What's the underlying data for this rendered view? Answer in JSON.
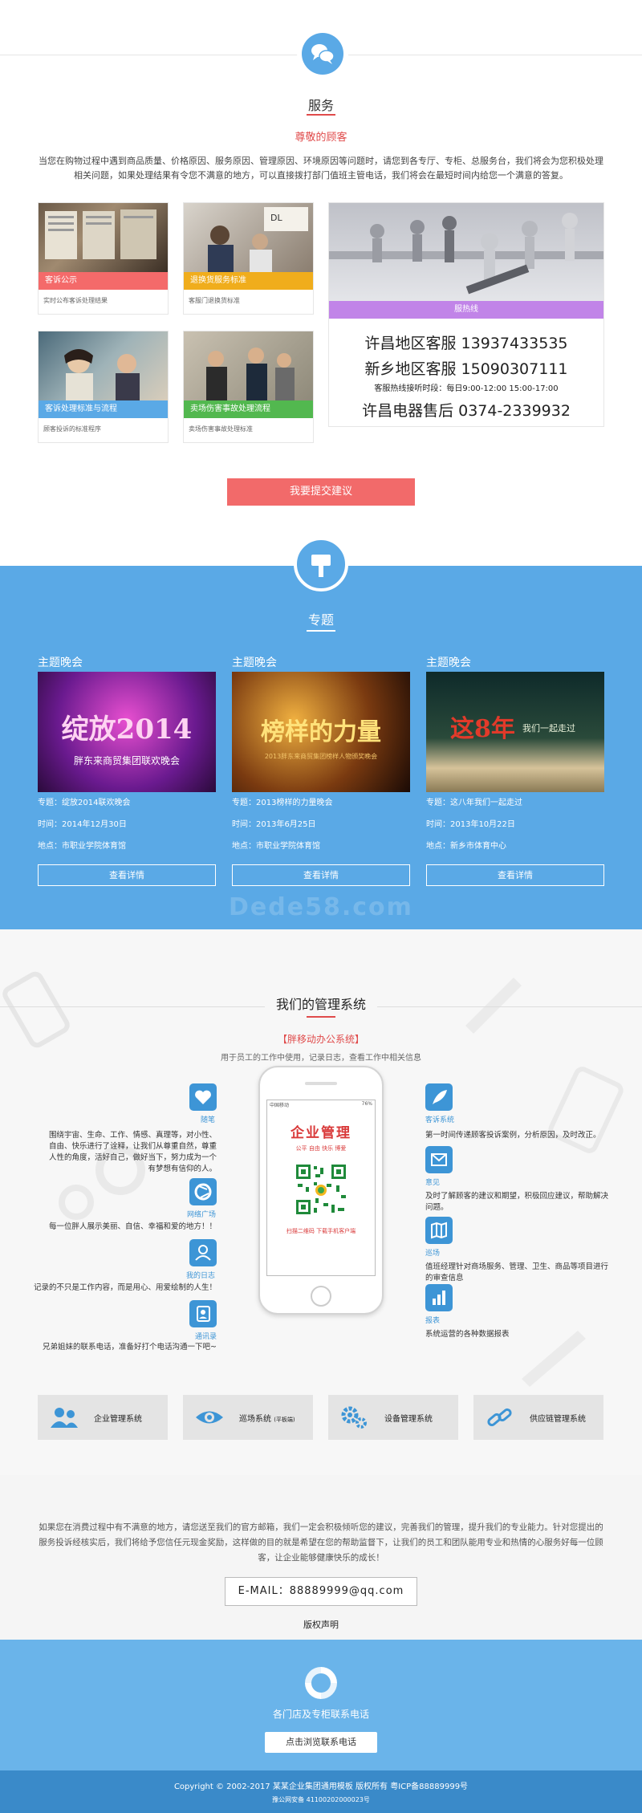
{
  "service": {
    "title": "服务",
    "subtitle": "尊敬的顾客",
    "description": "当您在购物过程中遇到商品质量、价格原因、服务原因、管理原因、环境原因等问题时，请您到各专厅、专柜、总服务台，我们将会为您积极处理相关问题，如果处理结果有令您不满意的地方，可以直接拨打部门值班主管电话，我们将会在最短时间内给您一个满意的答复。",
    "cards": [
      {
        "label": "客诉公示",
        "caption": "实时公布客诉处理结果",
        "color": "#f46a6a"
      },
      {
        "label": "退换货服务标准",
        "caption": "客服门退换货标准",
        "color": "#f0ad1c"
      },
      {
        "label": "客诉处理标准与流程",
        "caption": "顾客投诉的标准程序",
        "color": "#5aa9e6"
      },
      {
        "label": "卖场伤害事故处理流程",
        "caption": "卖场伤害事故处理标准",
        "color": "#52b84f"
      }
    ],
    "hotline": {
      "bar_label": "服热线",
      "line1": "许昌地区客服 13937433535",
      "line2": "新乡地区客服 15090307111",
      "hours": "客服热线接听时段：每日9:00-12:00 15:00-17:00",
      "line3": "许昌电器售后 0374-2339932"
    },
    "suggest_button": "我要提交建议"
  },
  "topic": {
    "title": "专题",
    "items": [
      {
        "head": "主题晚会",
        "img_text": "绽放2014",
        "img_sub": "胖东来商贸集团联欢晚会",
        "topic": "专题：绽放2014联欢晚会",
        "time": "时间：2014年12月30日",
        "place": "地点：市职业学院体育馆",
        "button": "查看详情"
      },
      {
        "head": "主题晚会",
        "img_text": "榜样的力量",
        "img_sub": "2013胖东来商贸集团榜样人物颁奖晚会",
        "topic": "专题：2013榜样的力量晚会",
        "time": "时间：2013年6月25日",
        "place": "地点：市职业学院体育馆",
        "button": "查看详情"
      },
      {
        "head": "主题晚会",
        "img_text": "这8年",
        "img_sub": "我们一起走过",
        "topic": "专题：这八年我们一起走过",
        "time": "时间：2013年10月22日",
        "place": "地点：新乡市体育中心",
        "button": "查看详情"
      }
    ],
    "watermark": "Dede58.com"
  },
  "mgmt": {
    "title": "我们的管理系统",
    "subtitle": "【胖移动办公系统】",
    "description": "用于员工的工作中使用，记录日志，查看工作中相关信息",
    "left": [
      {
        "label": "随笔",
        "text": "围绕宇宙、生命、工作、情感、真理等，对小性、自由、快乐进行了诠释，让我们从尊重自然，尊重人性的角度，活好自己，做好当下，努力成为一个有梦想有信仰的人。",
        "icon": "heart-icon"
      },
      {
        "label": "网络广场",
        "text": "每一位胖人展示美丽、自信、幸福和爱的地方！！",
        "icon": "aperture-icon"
      },
      {
        "label": "我的日志",
        "text": "记录的不只是工作内容，而是用心、用爱绘制的人生！",
        "icon": "user-icon"
      },
      {
        "label": "通讯录",
        "text": "兄弟姐妹的联系电话，准备好打个电话沟通一下吧~",
        "icon": "contact-book-icon"
      }
    ],
    "right": [
      {
        "label": "客诉系统",
        "text": "第一时间传递顾客投诉案例，分析原因，及时改正。",
        "icon": "feather-icon"
      },
      {
        "label": "意见",
        "text": "及时了解顾客的建议和期望，积极回应建议，帮助解决问题。",
        "icon": "mail-icon"
      },
      {
        "label": "巡场",
        "text": "值班经理针对商场服务、管理、卫生、商品等项目进行的审查信息",
        "icon": "map-icon"
      },
      {
        "label": "报表",
        "text": "系统运营的各种数据报表",
        "icon": "bar-chart-icon"
      }
    ],
    "phone": {
      "status_left": "中国移动",
      "status_right": "76%",
      "app_title": "企业管理",
      "slogan": "公平 自由 快乐 博爱",
      "scan": "扫描二维码  下载手机客户端"
    },
    "systems": [
      {
        "label": "企业管理系统",
        "icon": "users-icon"
      },
      {
        "label": "巡场系统",
        "label_small": "(平板端)",
        "icon": "eye-icon"
      },
      {
        "label": "设备管理系统",
        "icon": "gears-icon"
      },
      {
        "label": "供应链管理系统",
        "icon": "link-icon"
      }
    ]
  },
  "contact": {
    "description": "如果您在消费过程中有不满意的地方，请您送至我们的官方邮箱，我们一定会积极倾听您的建议，完善我们的管理，提升我们的专业能力。针对您提出的服务投诉经核实后，我们将给予您信任元现金奖励，这样做的目的就是希望在您的帮助监督下，让我们的员工和团队能用专业和热情的心服务好每一位顾客，让企业能够健康快乐的成长！",
    "email": "E-MAIL：88889999@qq.com",
    "copyright_link": "版权声明"
  },
  "store": {
    "title": "各门店及专柜联系电话",
    "button": "点击浏览联系电话"
  },
  "footer": {
    "copyright": "Copyright © 2002-2017 某某企业集团通用模板 版权所有    粤ICP备88889999号",
    "beian": "豫公网安备 41100202000023号"
  }
}
